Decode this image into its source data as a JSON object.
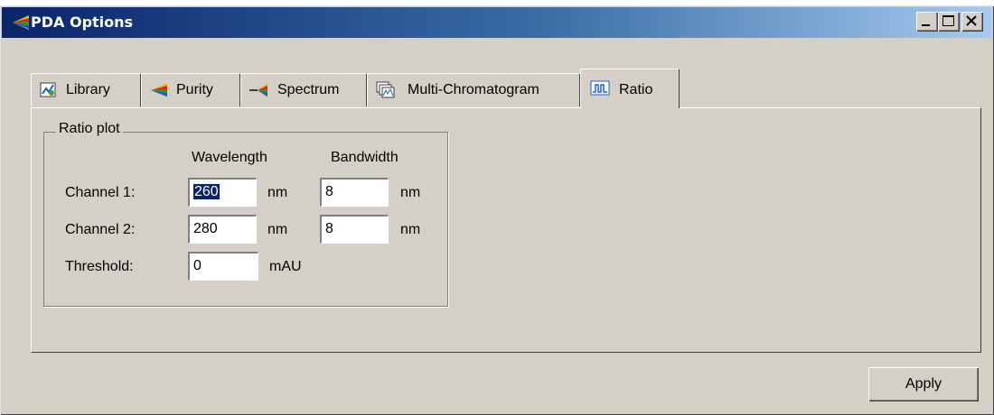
{
  "window": {
    "title": "PDA Options",
    "controls": {
      "minimize": "minimize-icon",
      "maximize": "maximize-icon",
      "close": "close-icon"
    }
  },
  "tabs": [
    {
      "label": "Library",
      "icon": "library-icon"
    },
    {
      "label": "Purity",
      "icon": "purity-icon"
    },
    {
      "label": "Spectrum",
      "icon": "spectrum-icon"
    },
    {
      "label": "Multi-Chromatogram",
      "icon": "multi-chromatogram-icon"
    },
    {
      "label": "Ratio",
      "icon": "ratio-icon",
      "active": true
    }
  ],
  "ratio_plot": {
    "group_title": "Ratio plot",
    "headers": {
      "wavelength": "Wavelength",
      "bandwidth": "Bandwidth"
    },
    "channel1": {
      "label": "Channel 1:",
      "wavelength": "260",
      "wavelength_unit": "nm",
      "bandwidth": "8",
      "bandwidth_unit": "nm"
    },
    "channel2": {
      "label": "Channel 2:",
      "wavelength": "280",
      "wavelength_unit": "nm",
      "bandwidth": "8",
      "bandwidth_unit": "nm"
    },
    "threshold": {
      "label": "Threshold:",
      "value": "0",
      "unit": "mAU"
    }
  },
  "buttons": {
    "apply": "Apply"
  }
}
